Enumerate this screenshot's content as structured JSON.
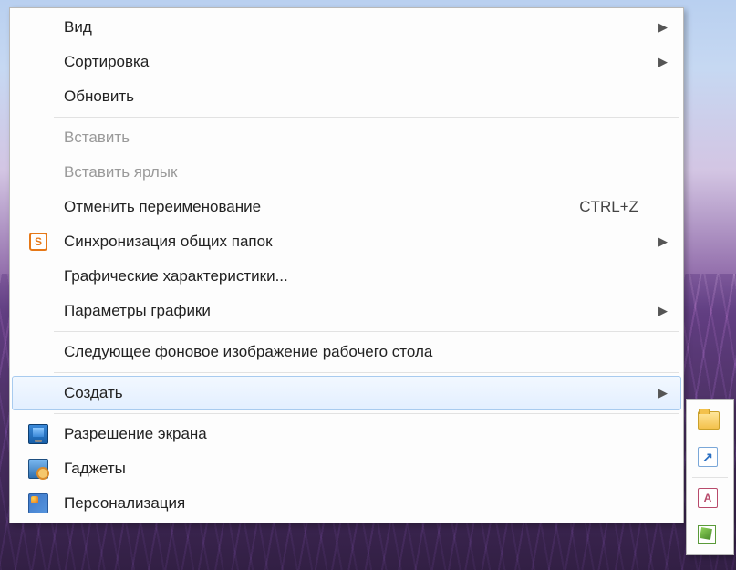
{
  "menu": {
    "view": {
      "label": "Вид",
      "has_submenu": true
    },
    "sort": {
      "label": "Сортировка",
      "has_submenu": true
    },
    "refresh": {
      "label": "Обновить"
    },
    "paste": {
      "label": "Вставить",
      "enabled": false
    },
    "paste_shortcut": {
      "label": "Вставить ярлык",
      "enabled": false
    },
    "undo_rename": {
      "label": "Отменить переименование",
      "hotkey": "CTRL+Z"
    },
    "sync_shared": {
      "label": "Синхронизация общих папок",
      "has_submenu": true
    },
    "gfx_props": {
      "label": "Графические характеристики..."
    },
    "gfx_params": {
      "label": "Параметры графики",
      "has_submenu": true
    },
    "next_wall": {
      "label": "Следующее фоновое изображение рабочего стола"
    },
    "create": {
      "label": "Создать",
      "has_submenu": true,
      "highlight": true
    },
    "resolution": {
      "label": "Разрешение экрана"
    },
    "gadgets": {
      "label": "Гаджеты"
    },
    "personalize": {
      "label": "Персонализация"
    }
  },
  "glyph": {
    "arrow": "▶"
  }
}
